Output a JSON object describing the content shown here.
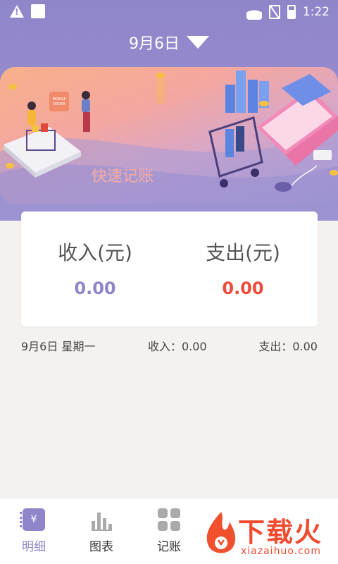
{
  "status_bar": {
    "time": "1:22"
  },
  "header": {
    "date": "9月6日"
  },
  "banner": {
    "text": "快速记账",
    "sign_text": "MOBILE ORDER"
  },
  "summary": {
    "income_label": "收入(元)",
    "income_value": "0.00",
    "expense_label": "支出(元)",
    "expense_value": "0.00"
  },
  "day_row": {
    "date": "9月6日  星期一",
    "income": "收入：0.00",
    "expense": "支出：0.00"
  },
  "nav": {
    "items": [
      {
        "label": "明细",
        "icon": "notebook-yen-icon",
        "icon_text": "¥"
      },
      {
        "label": "图表",
        "icon": "bar-chart-icon"
      },
      {
        "label": "记账",
        "icon": "grid-icon"
      }
    ]
  },
  "watermark": {
    "text": "下载火",
    "sub": "xiazaihuo.com"
  },
  "colors": {
    "accent": "#8f85c9",
    "expense": "#ef4a3a",
    "watermark": "#f04b2e"
  }
}
